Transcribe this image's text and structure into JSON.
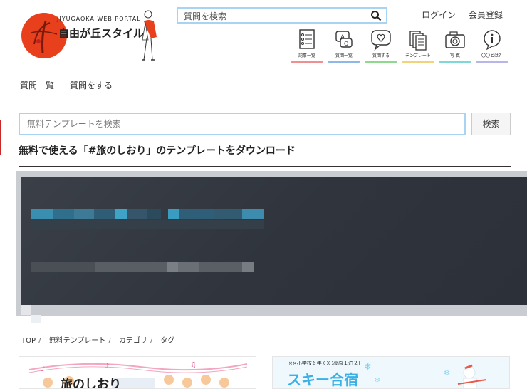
{
  "header": {
    "logo_sub": "JIYUGAOKA WEB PORTAL",
    "logo_main": "自由が丘スタイル",
    "search_placeholder": "質問を検索",
    "login": "ログイン",
    "register": "会員登録"
  },
  "icon_nav": [
    {
      "label": "記事一覧",
      "icon": "article-list-icon",
      "color": "#f08f8f"
    },
    {
      "label": "質問一覧",
      "icon": "question-list-icon",
      "color": "#8fb8e8"
    },
    {
      "label": "質問する",
      "icon": "ask-question-icon",
      "color": "#8fd98f"
    },
    {
      "label": "テンプレート",
      "icon": "template-icon",
      "color": "#f2d27a"
    },
    {
      "label": "写 真",
      "icon": "camera-icon",
      "color": "#7fd8d8"
    },
    {
      "label": "〇〇とは？",
      "icon": "info-icon",
      "color": "#b6b6e8"
    }
  ],
  "subnav": [
    "質問一覧",
    "質問をする"
  ],
  "template_search": {
    "placeholder": "無料テンプレートを検索",
    "button": "検索"
  },
  "heading": "無料で使える「#旅のしおり」のテンプレートをダウンロード",
  "breadcrumb": [
    "TOP",
    "無料テンプレート",
    "カテゴリ",
    "タグ"
  ],
  "cards": [
    {
      "title": "旅のしおり"
    },
    {
      "header": "××小学校６年 〇〇高原１泊２日",
      "title": "スキー合宿"
    }
  ]
}
